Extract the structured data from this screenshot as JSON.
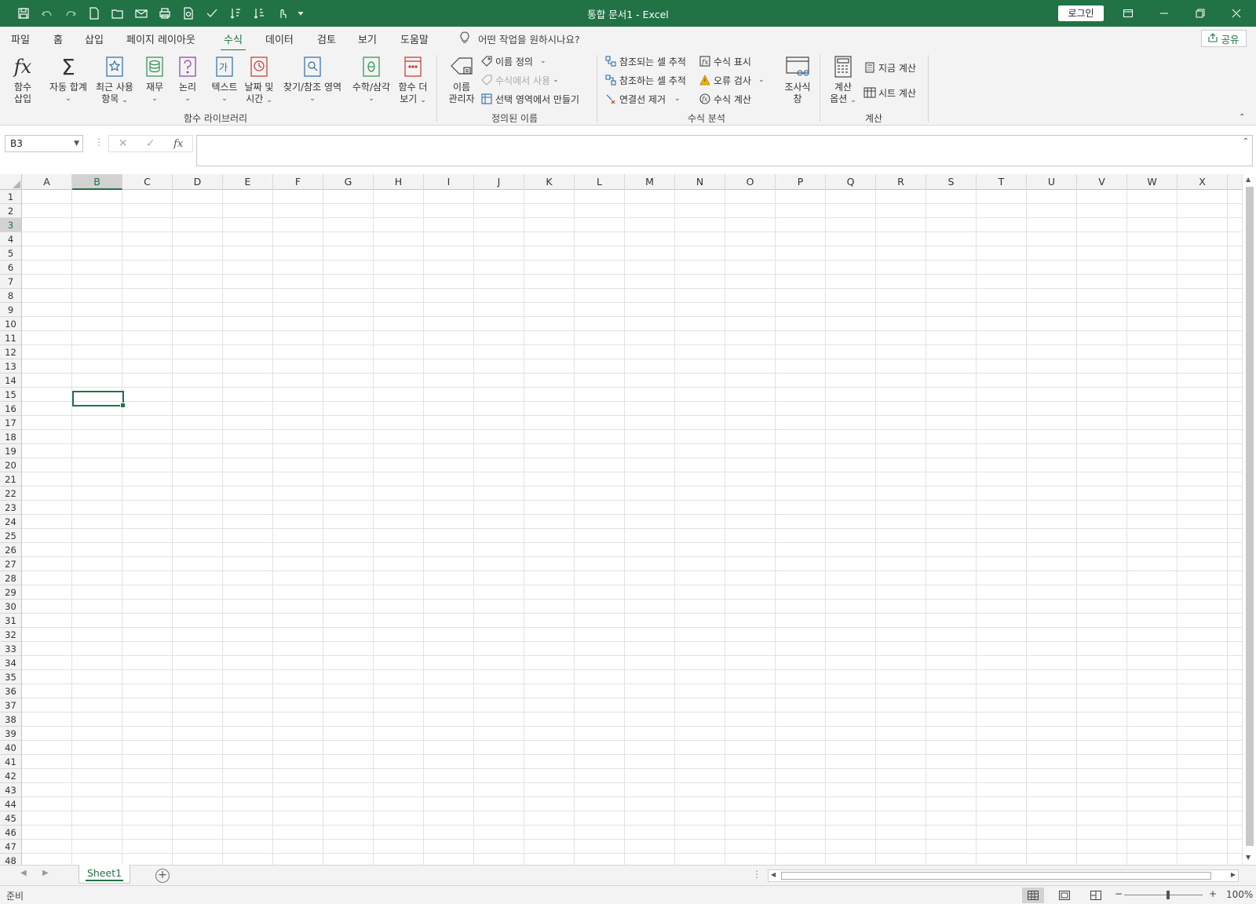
{
  "window": {
    "title": "통합 문서1  -  Excel",
    "login_label": "로그인"
  },
  "tabs": {
    "items": [
      "파일",
      "홈",
      "삽입",
      "페이지 레이아웃",
      "수식",
      "데이터",
      "검토",
      "보기",
      "도움말"
    ],
    "active": "수식",
    "tell_me": "어떤 작업을 원하시나요?",
    "share": "공유"
  },
  "ribbon": {
    "function_library": {
      "label": "함수 라이브러리",
      "insert_function_1": "함수",
      "insert_function_2": "삽입",
      "autosum": "자동 합계",
      "recent_1": "최근 사용",
      "recent_2": "항목",
      "financial": "재무",
      "logical": "논리",
      "text": "텍스트",
      "datetime_1": "날짜 및",
      "datetime_2": "시간",
      "lookup": "찾기/참조 영역",
      "math": "수학/삼각",
      "more_1": "함수 더",
      "more_2": "보기"
    },
    "defined_names": {
      "label": "정의된 이름",
      "name_manager_1": "이름",
      "name_manager_2": "관리자",
      "define_name": "이름 정의",
      "use_in_formula": "수식에서 사용",
      "create_from_selection": "선택 영역에서 만들기"
    },
    "formula_auditing": {
      "label": "수식 분석",
      "trace_precedents": "참조되는 셀 추적",
      "trace_dependents": "참조하는 셀 추적",
      "remove_arrows": "연결선 제거",
      "show_formulas": "수식 표시",
      "error_checking": "오류 검사",
      "evaluate_formula": "수식 계산",
      "watch_window_1": "조사식",
      "watch_window_2": "창"
    },
    "calculation": {
      "label": "계산",
      "options_1": "계산",
      "options_2": "옵션",
      "calc_now": "지금 계산",
      "calc_sheet": "시트 계산"
    }
  },
  "formula_bar": {
    "name_box": "B3",
    "formula": ""
  },
  "grid": {
    "columns": [
      "A",
      "B",
      "C",
      "D",
      "E",
      "F",
      "G",
      "H",
      "I",
      "J",
      "K",
      "L",
      "M",
      "N",
      "O",
      "P",
      "Q",
      "R",
      "S",
      "T",
      "U",
      "V",
      "W",
      "X"
    ],
    "rows": [
      "1",
      "2",
      "3",
      "4",
      "5",
      "6",
      "7",
      "8",
      "9",
      "10",
      "11",
      "12",
      "13",
      "14",
      "15",
      "16",
      "17",
      "18",
      "19",
      "20",
      "21",
      "22",
      "23",
      "24",
      "25",
      "26",
      "27",
      "28",
      "29",
      "30",
      "31",
      "32",
      "33",
      "34",
      "35",
      "36",
      "37",
      "38",
      "39",
      "40",
      "41",
      "42",
      "43",
      "44",
      "45",
      "46",
      "47",
      "48"
    ],
    "selected_column": "B",
    "selected_row": "3"
  },
  "sheets": {
    "items": [
      "Sheet1"
    ],
    "active": "Sheet1"
  },
  "status": {
    "text": "준비",
    "zoom": "100%",
    "zoom_minus": "−",
    "zoom_plus": "+"
  },
  "colors": {
    "accent": "#217346"
  }
}
